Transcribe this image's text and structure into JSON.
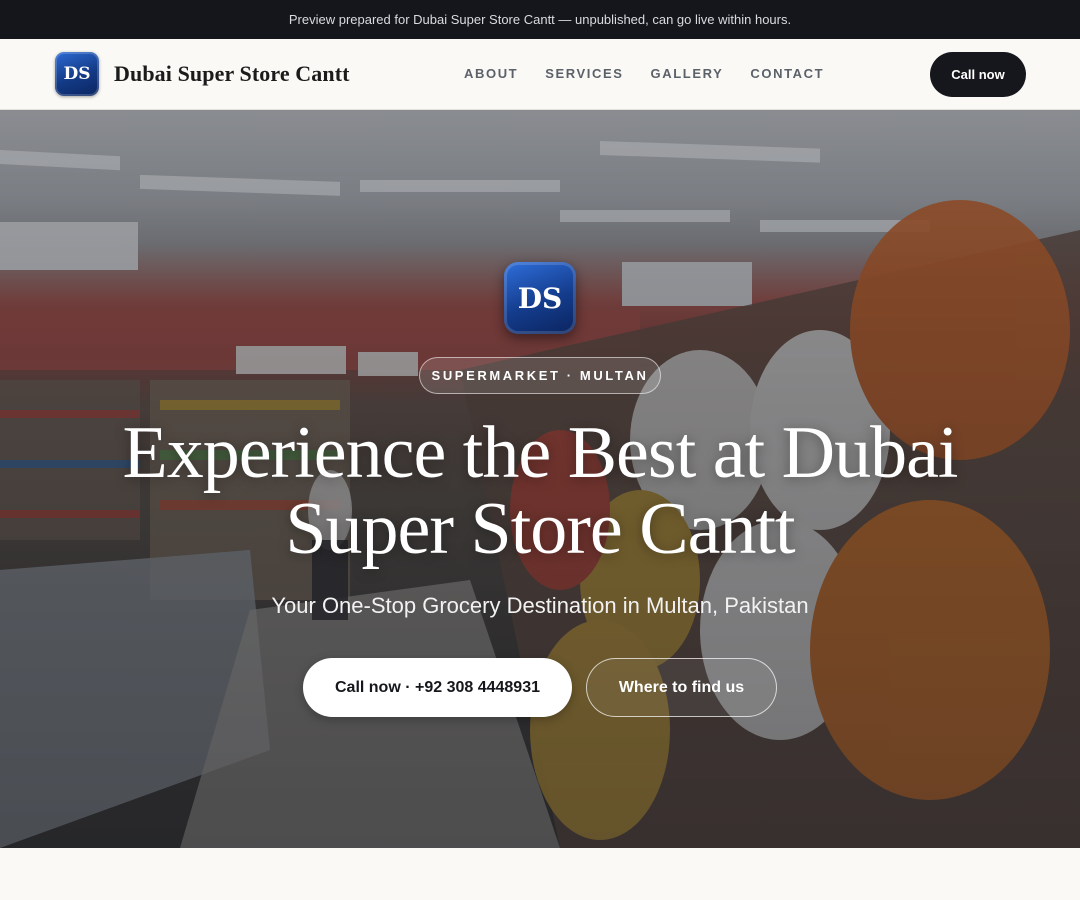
{
  "preview_banner": {
    "text": "Preview prepared for Dubai Super Store Cantt — unpublished, can go live within hours."
  },
  "header": {
    "logo_text": "DS",
    "brand_name": "Dubai Super Store Cantt",
    "nav": [
      {
        "label": "ABOUT"
      },
      {
        "label": "SERVICES"
      },
      {
        "label": "GALLERY"
      },
      {
        "label": "CONTACT"
      }
    ],
    "cta_label": "Call now"
  },
  "hero": {
    "logo_text": "DS",
    "tag": "SUPERMARKET · MULTAN",
    "title": "Experience the Best at Dubai Super Store Cantt",
    "subtitle": "Your One-Stop Grocery Destination in Multan, Pakistan",
    "primary_button": "Call now · +92 308 4448931",
    "secondary_button": "Where to find us"
  },
  "colors": {
    "banner_bg": "#14161b",
    "header_bg": "#faf9f6",
    "dark_button": "#15171c",
    "logo_blue": "#133a86",
    "nav_text": "#5b6169"
  }
}
